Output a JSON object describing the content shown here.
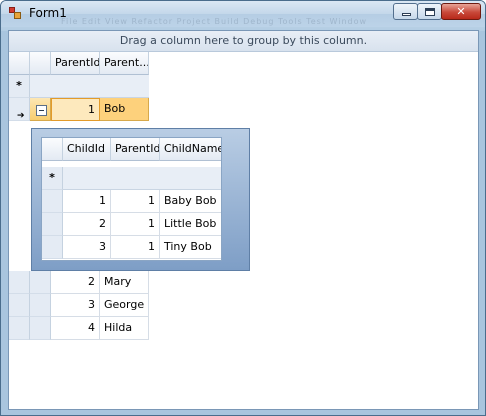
{
  "window": {
    "title": "Form1",
    "ghost_menu": "File  Edit  View  Refactor  Project  Build  Debug  Tools  Test  Window"
  },
  "controls": {
    "minimize": "–",
    "maximize": "□",
    "close": "✕"
  },
  "grid": {
    "group_panel_text": "Drag a column here to group by this column.",
    "columns": [
      "ParentId",
      "Parent..."
    ],
    "new_row_marker": "*",
    "current_row_marker": "➔",
    "rows": [
      {
        "parent_id": "1",
        "name": "Bob",
        "expanded": true
      },
      {
        "parent_id": "2",
        "name": "Mary",
        "expanded": false
      },
      {
        "parent_id": "3",
        "name": "George",
        "expanded": false
      },
      {
        "parent_id": "4",
        "name": "Hilda",
        "expanded": false
      }
    ]
  },
  "child_grid": {
    "columns": [
      "ChildId",
      "ParentId",
      "ChildName"
    ],
    "new_row_marker": "*",
    "rows": [
      {
        "child_id": "1",
        "parent_id": "1",
        "child_name": "Baby Bob"
      },
      {
        "child_id": "2",
        "parent_id": "1",
        "child_name": "Little Bob"
      },
      {
        "child_id": "3",
        "parent_id": "1",
        "child_name": "Tiny Bob"
      }
    ]
  }
}
